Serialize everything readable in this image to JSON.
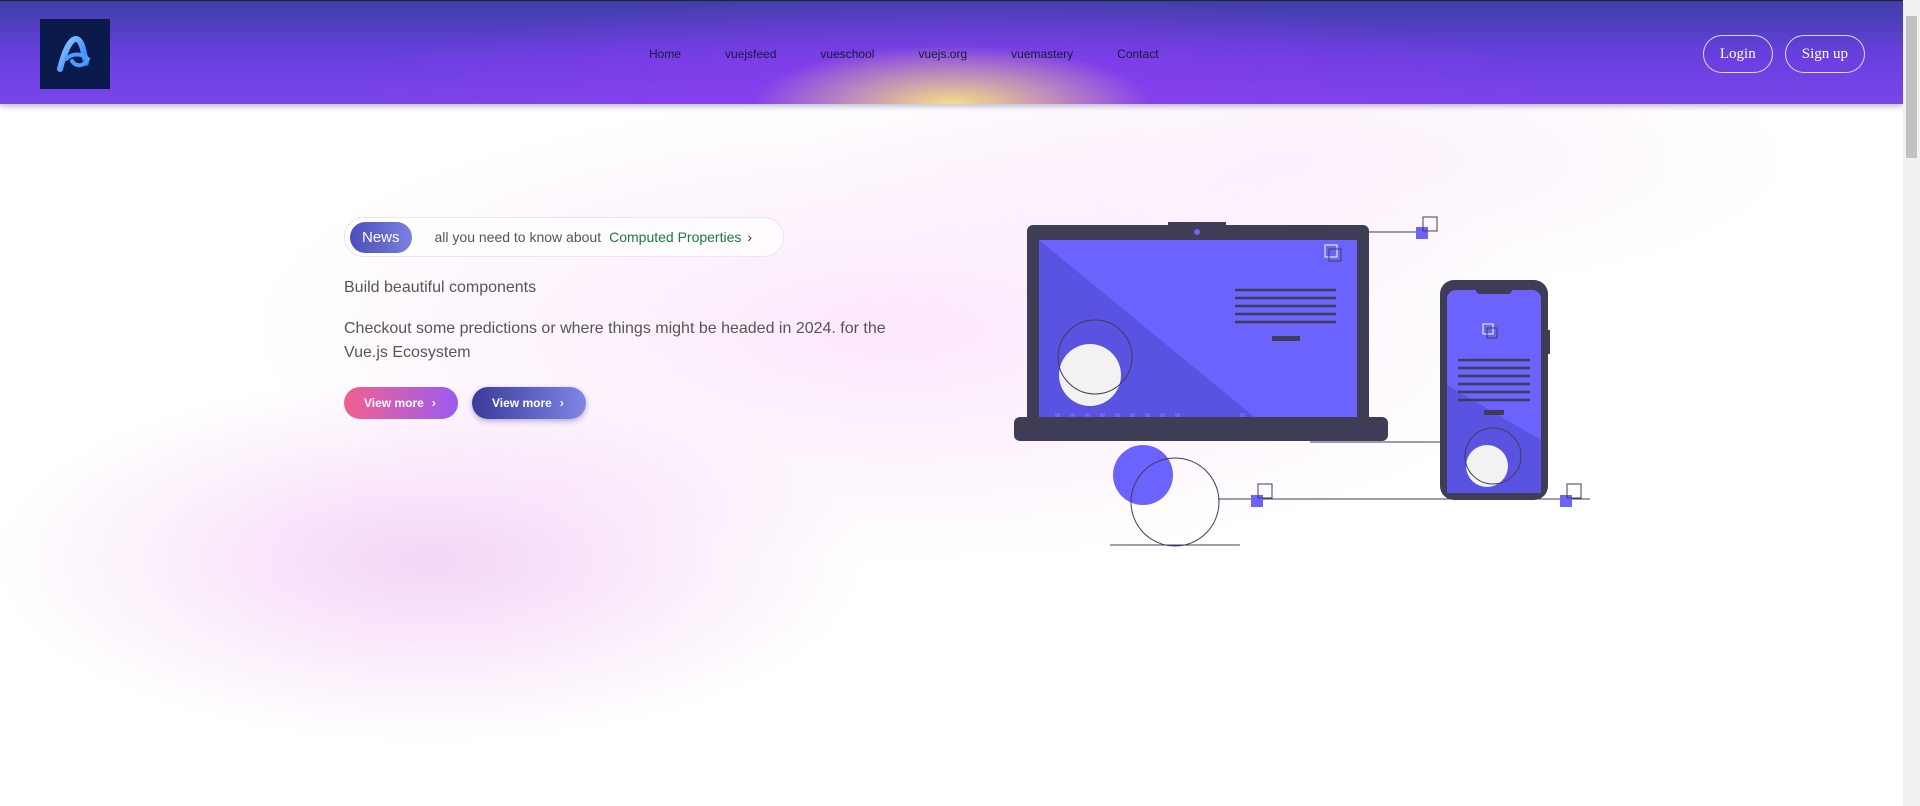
{
  "nav": {
    "links": [
      "Home",
      "vuejsfeed",
      "vueschool",
      "vuejs.org",
      "vuemastery",
      "Contact"
    ],
    "login_label": "Login",
    "signup_label": "Sign up"
  },
  "hero": {
    "news_badge": "News",
    "news_text": "all you need to know about",
    "news_link": "Computed Properties",
    "subtitle": "Build beautiful components",
    "description": "Checkout some predictions or where things might be headed in 2024. for the Vue.js Ecosystem",
    "cta_primary": "View more",
    "cta_secondary": "View more"
  },
  "colors": {
    "accent": "#6c63ff",
    "link_green": "#1a7a3a",
    "nav_purple": "#7a45e8",
    "device_dark": "#3f3d56"
  },
  "icons": [
    "logo-icon",
    "chevron-right-icon",
    "laptop-illustration",
    "phone-illustration"
  ]
}
